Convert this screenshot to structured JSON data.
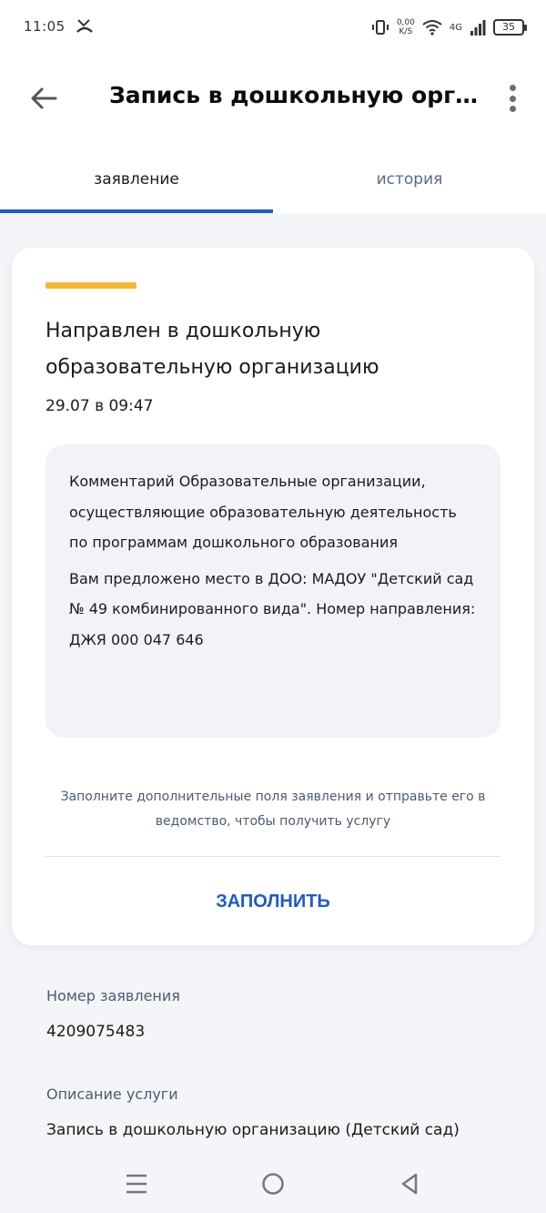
{
  "status_bar": {
    "time": "11:05",
    "net_speed_value": "0,00",
    "net_speed_unit": "K/S",
    "network_type": "4G",
    "battery": "35"
  },
  "app_bar": {
    "title": "Запись в дошкольную орга..."
  },
  "tabs": [
    {
      "label": "заявление",
      "active": true
    },
    {
      "label": "история",
      "active": false
    }
  ],
  "card": {
    "status_title": "Направлен в дошкольную образовательную организацию",
    "status_date": "29.07 в 09:47",
    "comment_text": "Комментарий Образовательные организации, осуществляющие образовательную деятельность по программам дошкольного образования",
    "offer_text": "Вам предложено место в ДОО: МАДОУ \"Детский сад № 49 комбинированного вида\". Номер направления: ДЖЯ 000 047 646",
    "hint": "Заполните дополнительные поля заявления и отправьте его в ведомство, чтобы получить услугу",
    "fill_button": "ЗАПОЛНИТЬ"
  },
  "details": {
    "application_number_label": "Номер заявления",
    "application_number": "4209075483",
    "service_description_label": "Описание услуги",
    "service_description": "Запись в дошкольную организацию (Детский сад)"
  },
  "colors": {
    "accent": "#1f5cc6",
    "status_stripe": "#f5b830",
    "comment_bg": "#f1f3f8",
    "muted_text": "#4c5a73"
  }
}
